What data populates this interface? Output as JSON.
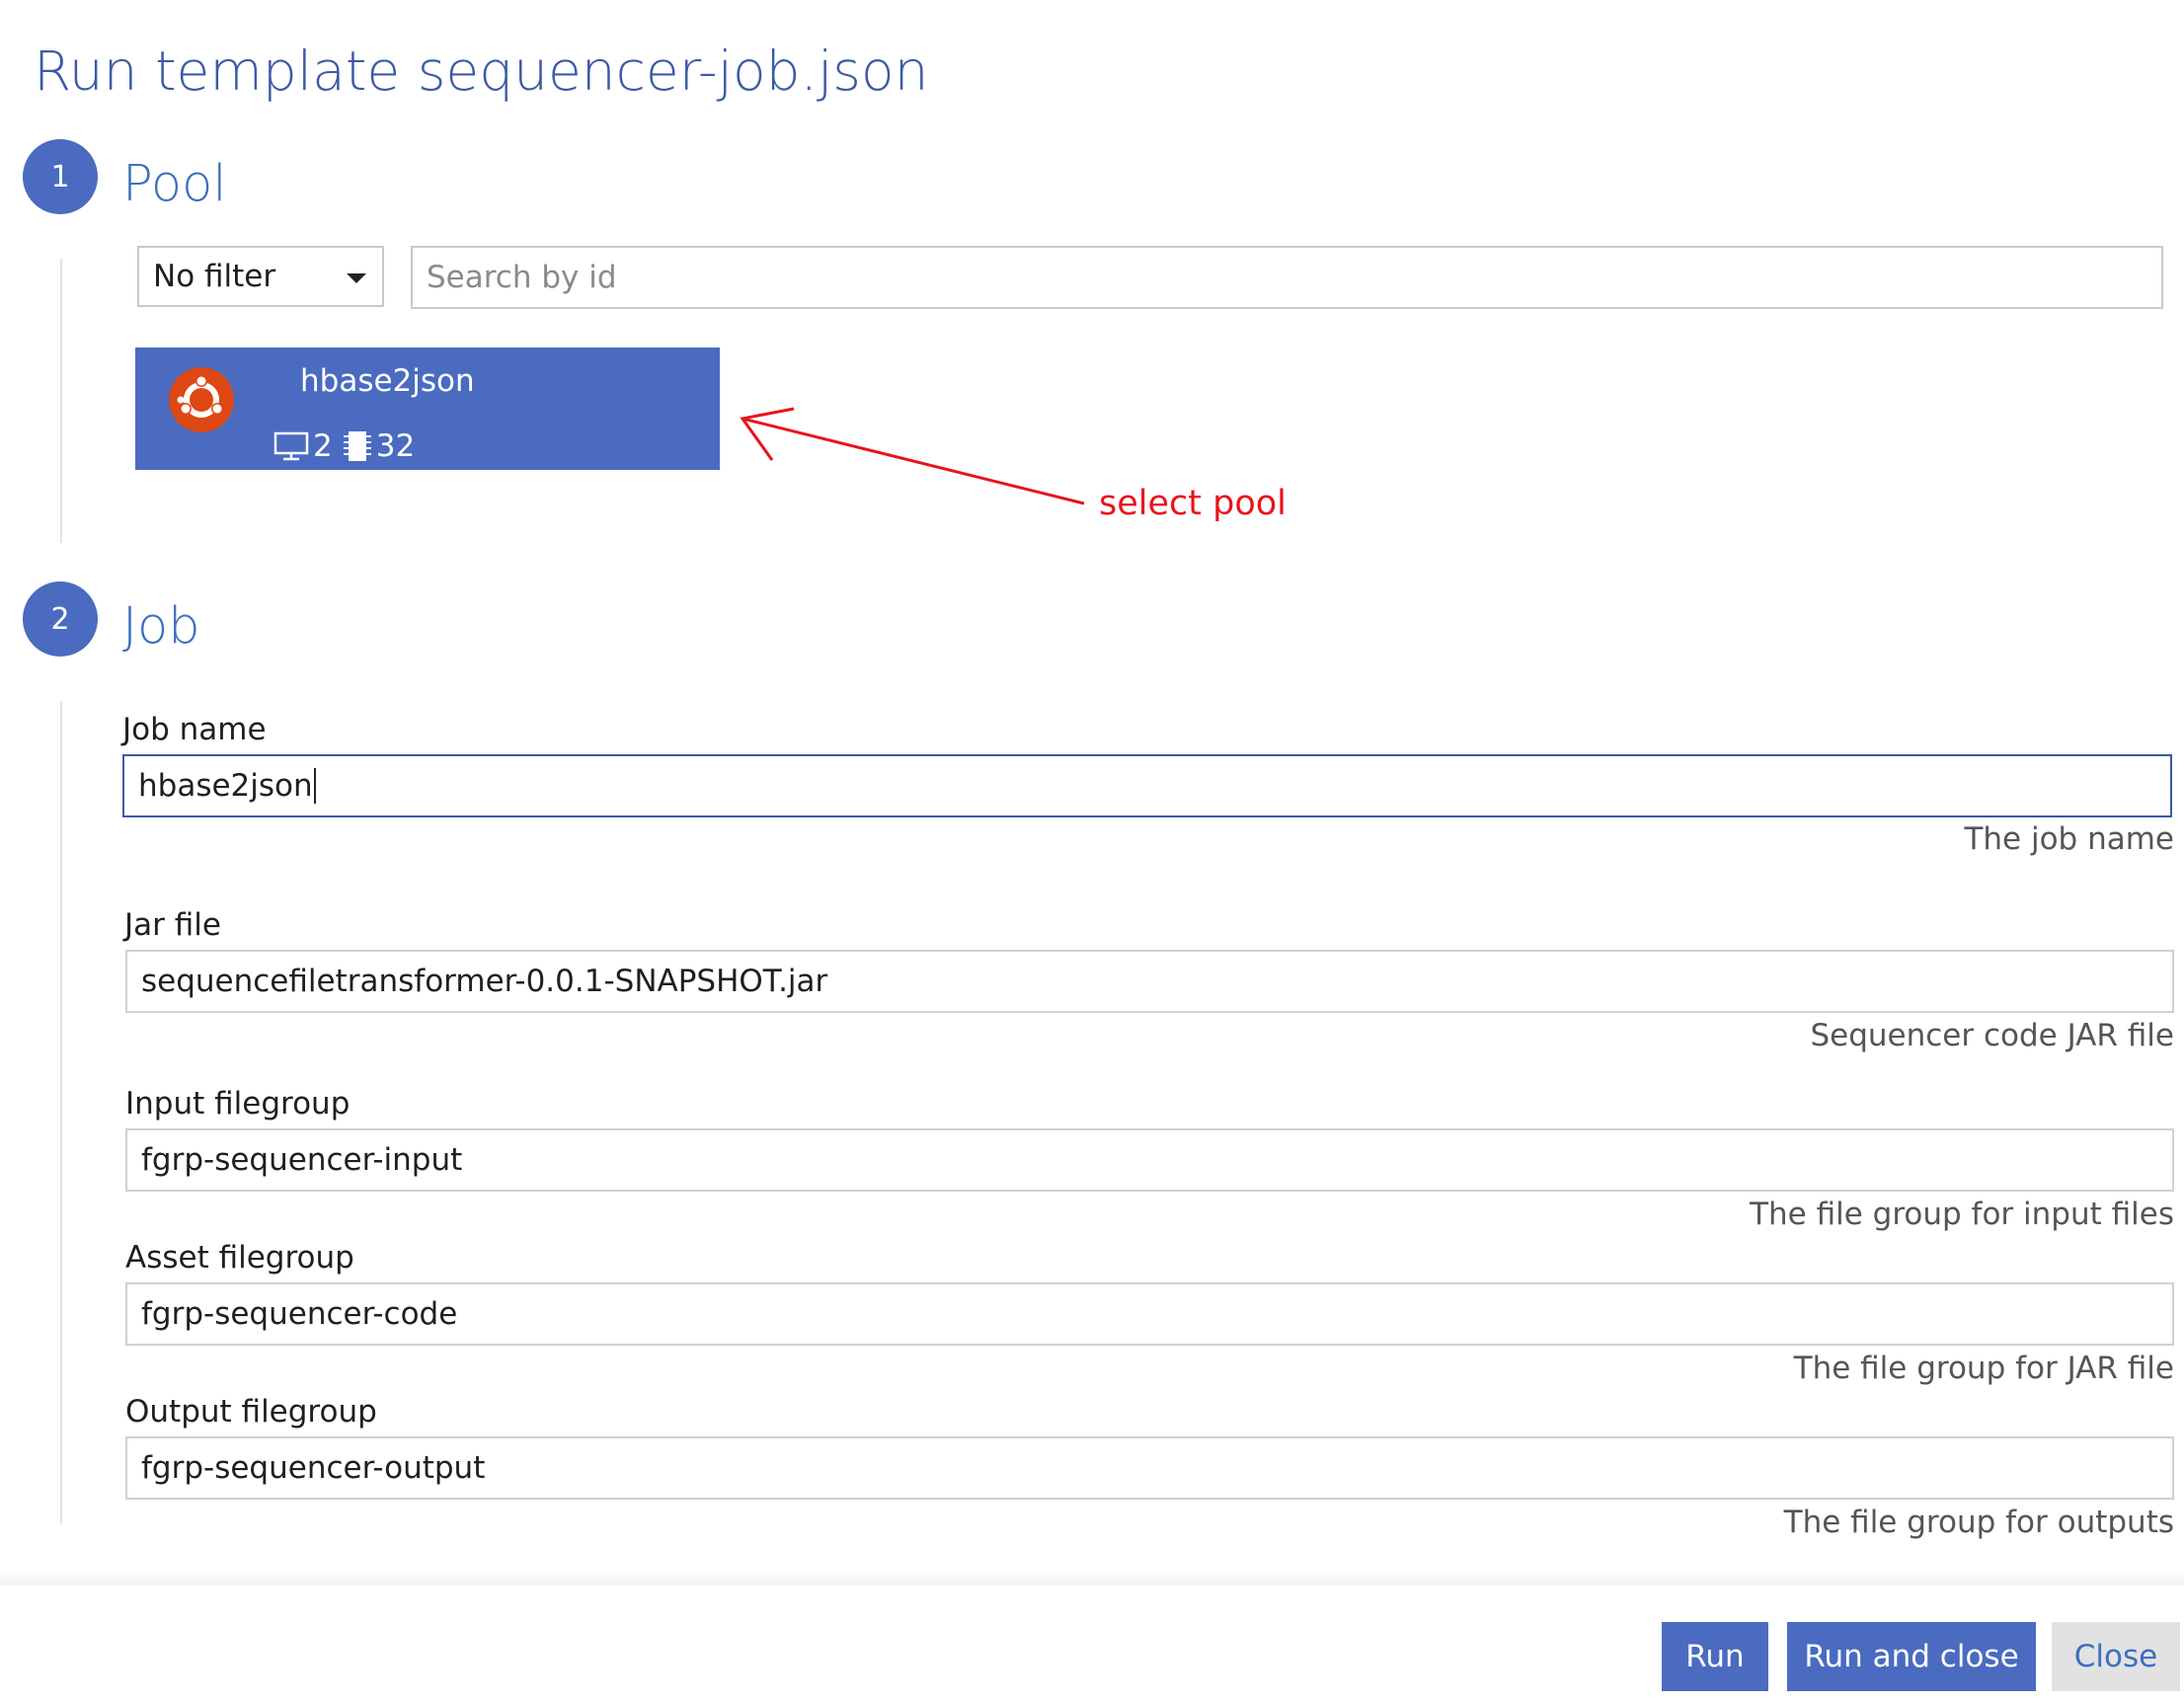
{
  "dialog": {
    "title": "Run template sequencer-job.json"
  },
  "steps": [
    {
      "number": "1",
      "title": "Pool"
    },
    {
      "number": "2",
      "title": "Job"
    }
  ],
  "pool": {
    "filter": {
      "value": "No filter"
    },
    "search": {
      "placeholder": "Search by id",
      "value": ""
    },
    "items": [
      {
        "name": "hbase2json",
        "os_icon": "ubuntu-icon",
        "nodes": "2",
        "cores": "32",
        "selected": true
      }
    ]
  },
  "annotation": {
    "text": "select pool",
    "color": "#e8141c"
  },
  "job": {
    "fields": [
      {
        "label": "Job name",
        "value": "hbase2json",
        "hint": "The job name"
      },
      {
        "label": "Jar file",
        "value": "sequencefiletransformer-0.0.1-SNAPSHOT.jar",
        "hint": "Sequencer code JAR file"
      },
      {
        "label": "Input filegroup",
        "value": "fgrp-sequencer-input",
        "hint": "The file group for input files"
      },
      {
        "label": "Asset filegroup",
        "value": "fgrp-sequencer-code",
        "hint": "The file group for JAR file"
      },
      {
        "label": "Output filegroup",
        "value": "fgrp-sequencer-output",
        "hint": "The file group for outputs"
      }
    ]
  },
  "footer": {
    "run_label": "Run",
    "run_close_label": "Run and close",
    "close_label": "Close"
  },
  "colors": {
    "accent": "#4a6bbf",
    "title": "#3c5aa6"
  }
}
